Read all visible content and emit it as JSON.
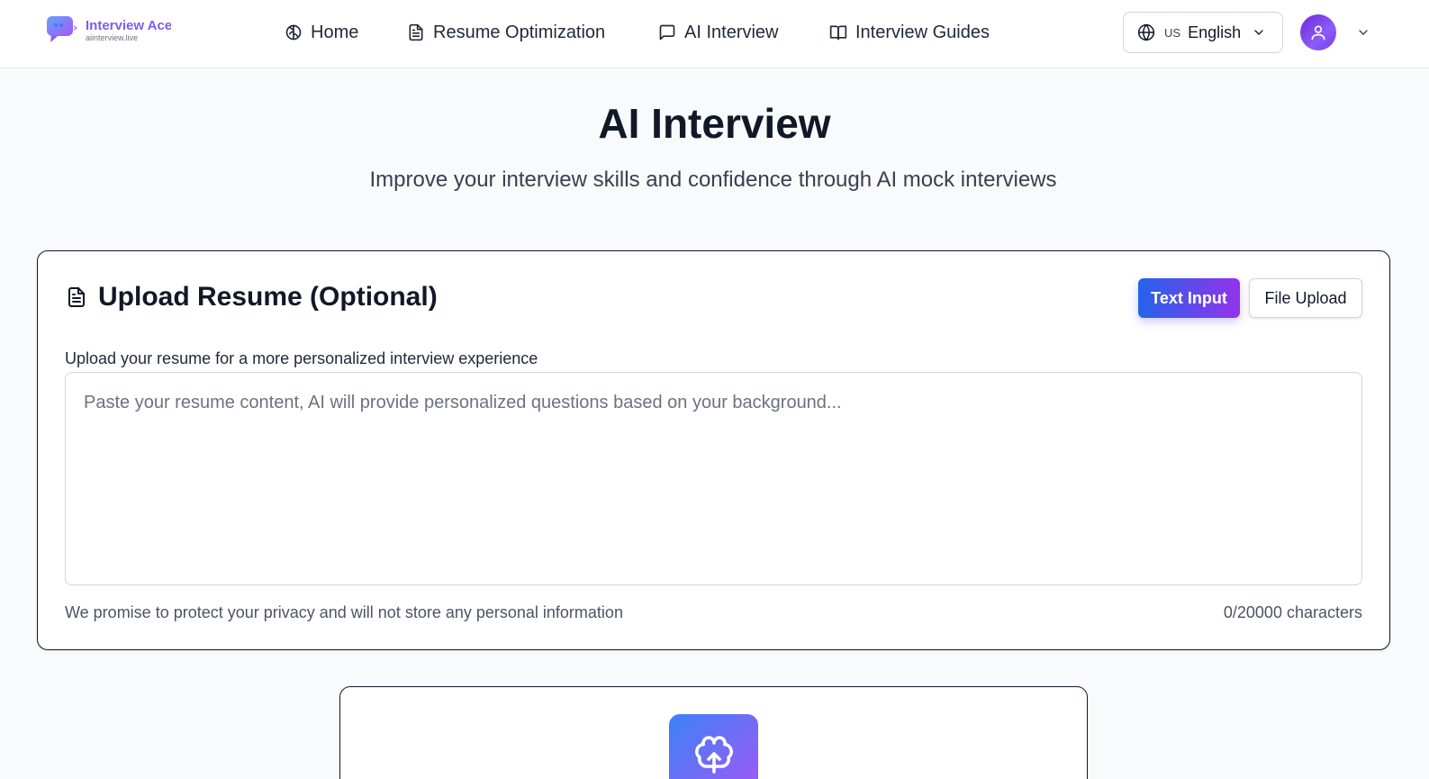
{
  "header": {
    "logo_name": "Interview Ace",
    "logo_url": "aiinterview.live",
    "nav": {
      "home": "Home",
      "resume": "Resume Optimization",
      "ai_interview": "AI Interview",
      "guides": "Interview Guides"
    },
    "language": {
      "flag": "US",
      "label": "English"
    }
  },
  "hero": {
    "title": "AI Interview",
    "subtitle": "Improve your interview skills and confidence through AI mock interviews"
  },
  "upload_card": {
    "title": "Upload Resume (Optional)",
    "tab_text": "Text Input",
    "tab_file": "File Upload",
    "label": "Upload your resume for a more personalized interview experience",
    "placeholder": "Paste your resume content, AI will provide personalized questions based on your background...",
    "value": "",
    "privacy": "We promise to protect your privacy and will not store any personal information",
    "counter": "0/20000 characters"
  },
  "colors": {
    "accent_start": "#2563eb",
    "accent_end": "#9333ea",
    "avatar": "#7c3aed"
  },
  "icons": {
    "home": "brain-icon",
    "resume": "document-icon",
    "ai_interview": "chat-bubble-icon",
    "guides": "book-icon",
    "language": "globe-icon",
    "user": "user-icon"
  }
}
